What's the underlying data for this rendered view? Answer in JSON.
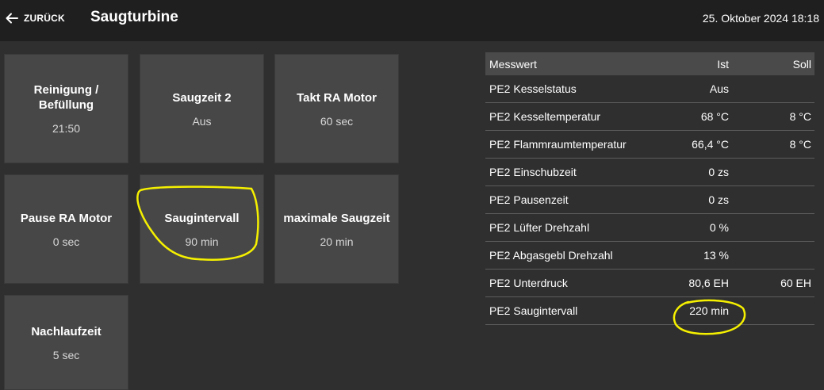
{
  "header": {
    "back_label": "ZURÜCK",
    "title": "Saugturbine",
    "datetime": "25. Oktober 2024 18:18"
  },
  "tiles": [
    {
      "label": "Reinigung / Befüllung",
      "value": "21:50"
    },
    {
      "label": "Saugzeit 2",
      "value": "Aus"
    },
    {
      "label": "Takt RA Motor",
      "value": "60 sec"
    },
    {
      "label": "Pause RA Motor",
      "value": "0 sec"
    },
    {
      "label": "Saugintervall",
      "value": "90 min"
    },
    {
      "label": "maximale Saugzeit",
      "value": "20 min"
    },
    {
      "label": "Nachlaufzeit",
      "value": "5 sec"
    }
  ],
  "table": {
    "headers": {
      "name": "Messwert",
      "ist": "Ist",
      "soll": "Soll"
    },
    "rows": [
      {
        "name": "PE2 Kesselstatus",
        "ist": "Aus",
        "soll": ""
      },
      {
        "name": "PE2 Kesseltemperatur",
        "ist": "68 °C",
        "soll": "8 °C"
      },
      {
        "name": "PE2 Flammraumtemperatur",
        "ist": "66,4 °C",
        "soll": "8 °C"
      },
      {
        "name": "PE2 Einschubzeit",
        "ist": "0 zs",
        "soll": ""
      },
      {
        "name": "PE2 Pausenzeit",
        "ist": "0 zs",
        "soll": ""
      },
      {
        "name": "PE2 Lüfter Drehzahl",
        "ist": "0 %",
        "soll": ""
      },
      {
        "name": "PE2 Abgasgebl Drehzahl",
        "ist": "13 %",
        "soll": ""
      },
      {
        "name": "PE2 Unterdruck",
        "ist": "80,6 EH",
        "soll": "60 EH"
      },
      {
        "name": "PE2 Saugintervall",
        "ist": "220 min",
        "soll": ""
      }
    ]
  },
  "colors": {
    "annotation": "#f5f000"
  },
  "icons": {
    "back": "arrow-left-icon"
  }
}
